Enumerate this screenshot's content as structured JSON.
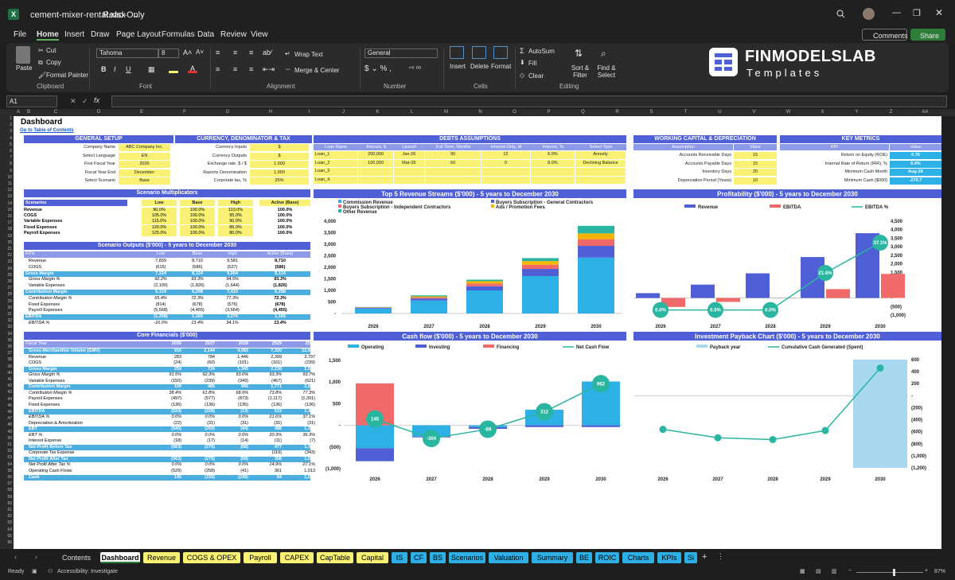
{
  "app": {
    "filename": "cement-mixer-rental.xlsx",
    "mode": "Read-Only"
  },
  "menu": [
    "File",
    "Home",
    "Insert",
    "Draw",
    "Page Layout",
    "Formulas",
    "Data",
    "Review",
    "View"
  ],
  "title_right": {
    "comments": "Comments",
    "share": "Share"
  },
  "ribbon": {
    "paste": "Paste",
    "cut": "Cut",
    "copy": "Copy",
    "format_painter": "Format Painter",
    "clipboard": "Clipboard",
    "font_name": "Tahoma",
    "font_size": "8",
    "font": "Font",
    "wrap": "Wrap Text",
    "merge": "Merge & Center",
    "alignment": "Alignment",
    "number_format": "General",
    "number": "Number",
    "insert": "Insert",
    "delete": "Delete",
    "format": "Format",
    "cells": "Cells",
    "autosum": "AutoSum",
    "fill": "Fill",
    "clear": "Clear",
    "sort": "Sort & Filter",
    "find": "Find & Select",
    "editing": "Editing",
    "logo_main": "FINMODELSLAB",
    "logo_sub": "Templates"
  },
  "name_box": "A1",
  "columns": [
    "A",
    "B",
    "C",
    "D",
    "E",
    "F",
    "G",
    "H",
    "I",
    "J",
    "K",
    "L",
    "M",
    "N",
    "O",
    "P",
    "Q",
    "R",
    "S",
    "T",
    "U",
    "V",
    "W",
    "X",
    "Y",
    "Z",
    "AA",
    "AB",
    "AC"
  ],
  "sheet": {
    "title": "Dashboard",
    "link": "Go to Table of Contents"
  },
  "general": {
    "title": "GENERAL SETUP",
    "rows": [
      [
        "Company Name",
        "ABC Company Inc."
      ],
      [
        "Select Language",
        "EN"
      ],
      [
        "First Fiscal Year",
        "2026"
      ],
      [
        "Fiscal Year End",
        "December"
      ],
      [
        "Select Scenario",
        "Base"
      ]
    ]
  },
  "currency": {
    "title": "CURRENCY, DENOMINATOR & TAX",
    "rows": [
      [
        "Currency Inputs",
        "$"
      ],
      [
        "Currency Outputs",
        "$"
      ],
      [
        "Exchange rate, $ / $",
        "1.000"
      ],
      [
        "Reports Denomination",
        "1,000"
      ],
      [
        "Corporate tax, %",
        "25%"
      ]
    ]
  },
  "debts": {
    "title": "DEBTS ASSUMPTIONS",
    "headers": [
      "Loan Name",
      "Amount, $",
      "Launch",
      "Full Term, Months",
      "Interest-Only, M",
      "Interest, %",
      "Select Type"
    ],
    "rows": [
      [
        "Loan_1",
        "200,000",
        "Jan-26",
        "90",
        "12",
        "6.0%",
        "Annuity"
      ],
      [
        "Loan_2",
        "100,000",
        "Mar-26",
        "60",
        "0",
        "8.0%",
        "Declining Balance"
      ],
      [
        "Loan_3",
        "",
        "",
        "",
        "",
        "",
        ""
      ],
      [
        "Loan_4",
        "",
        "",
        "",
        "",
        "",
        ""
      ]
    ]
  },
  "wc": {
    "title": "WORKING CAPITAL & DEPRECIATION",
    "headers": [
      "Assumption",
      "Value"
    ],
    "rows": [
      [
        "Accounts Receivable Days",
        "15"
      ],
      [
        "Accounts Payable Days",
        "15"
      ],
      [
        "Inventory Days",
        "20"
      ],
      [
        "Depreciation Period (Years)",
        "10"
      ]
    ]
  },
  "kpi": {
    "title": "KEY METRICS",
    "headers": [
      "KPI",
      "Value"
    ],
    "rows": [
      [
        "Return on Equity (ROE)",
        "0.70"
      ],
      [
        "Internal Rate of Return (IRR), %",
        "0.4%"
      ],
      [
        "Minimum Cash Month",
        "Aug-28"
      ],
      [
        "Minimum Cash ($000)",
        "-270.7"
      ]
    ]
  },
  "scen": {
    "title": "Scenario Multiplicators",
    "headers": [
      "Scenarios",
      "Low",
      "Base",
      "High",
      "Active (Base)"
    ],
    "rows": [
      [
        "Revenue",
        "90.0%",
        "100.0%",
        "110.0%",
        "100.0%"
      ],
      [
        "COGS",
        "105.0%",
        "100.0%",
        "95.0%",
        "100.0%"
      ],
      [
        "Variable Expenses",
        "115.0%",
        "100.0%",
        "90.0%",
        "100.0%"
      ],
      [
        "Fixed Expenses",
        "120.0%",
        "100.0%",
        "85.0%",
        "100.0%"
      ],
      [
        "Payroll Expenses",
        "125.0%",
        "100.0%",
        "80.0%",
        "100.0%"
      ]
    ]
  },
  "outputs": {
    "title": "Scenario Outputs ($'000) - 5 years to December 2030",
    "headers": [
      "KPIs",
      "Low",
      "Base",
      "High",
      "Active (Base)"
    ],
    "rows": [
      [
        "Revenue",
        "7,839",
        "8,710",
        "9,581",
        "8,710",
        "n"
      ],
      [
        "COGS",
        "(615)",
        "(586)",
        "(527)",
        "(586)",
        "n"
      ],
      [
        "Gross Margin",
        "7,224",
        "8,124",
        "9,054",
        "8,124",
        "b"
      ],
      [
        "Gross Margin %",
        "92.2%",
        "93.3%",
        "94.5%",
        "93.3%",
        "i"
      ],
      [
        "Variable Expenses",
        "(2,100)",
        "(1,826)",
        "(1,644)",
        "(1,826)",
        "n"
      ],
      [
        "Contribution Margin",
        "5,124",
        "6,298",
        "7,410",
        "6,298",
        "b"
      ],
      [
        "Contribution Margin %",
        "65.4%",
        "72.3%",
        "77.3%",
        "72.3%",
        "i"
      ],
      [
        "Fixed Expenses",
        "(814)",
        "(678)",
        "(576)",
        "(678)",
        "n"
      ],
      [
        "Payroll Expenses",
        "(5,568)",
        "(4,455)",
        "(3,564)",
        "(4,455)",
        "n"
      ],
      [
        "EBITDA",
        "(1,258)",
        "1,165",
        "3,270",
        "1,165",
        "b"
      ],
      [
        "EBITDA %",
        "-16.0%",
        "13.4%",
        "34.1%",
        "13.4%",
        "i"
      ]
    ]
  },
  "core": {
    "title": "Core Financials ($'000)",
    "headers": [
      "Fiscal Year",
      "2026",
      "2027",
      "2028",
      "2029",
      "2030"
    ],
    "rows": [
      [
        "Gross Merchandise Volume (GMV)",
        "916",
        "2,144",
        "4,082",
        "7,320",
        "12,645",
        "b"
      ],
      [
        "Revenue",
        "283",
        "784",
        "1,446",
        "2,399",
        "3,797",
        "n"
      ],
      [
        "COGS",
        "(24)",
        "(60)",
        "(101)",
        "(161)",
        "(239)",
        "n"
      ],
      [
        "Gross Margin",
        "259",
        "724",
        "1,345",
        "2,238",
        "3,558",
        "b"
      ],
      [
        "Gross Margin %",
        "91.5%",
        "92.3%",
        "93.0%",
        "93.3%",
        "93.7%",
        "i"
      ],
      [
        "Variable Expenses",
        "(150)",
        "(239)",
        "(349)",
        "(467)",
        "(621)",
        "n"
      ],
      [
        "Contribution Margin",
        "109",
        "485",
        "996",
        "1,771",
        "2,937",
        "b"
      ],
      [
        "Contribution Margin %",
        "38.4%",
        "61.8%",
        "68.9%",
        "73.8%",
        "77.3%",
        "i"
      ],
      [
        "Payroll Expenses",
        "(497)",
        "(577)",
        "(873)",
        "(1,117)",
        "(1,391)",
        "n"
      ],
      [
        "Fixed Expenses",
        "(136)",
        "(136)",
        "(136)",
        "(136)",
        "(136)",
        "n"
      ],
      [
        "EBITDA",
        "(524)",
        "(228)",
        "(13)",
        "519",
        "1,411",
        "b"
      ],
      [
        "EBITDA %",
        "0.0%",
        "0.0%",
        "0.0%",
        "21.6%",
        "37.1%",
        "i"
      ],
      [
        "Depreciation & Amortization",
        "(22)",
        "(31)",
        "(31)",
        "(31)",
        "(31)",
        "n"
      ],
      [
        "EBT",
        "(545)",
        "(259)",
        "(44)",
        "488",
        "1,380",
        "b"
      ],
      [
        "EBT %",
        "0.0%",
        "0.0%",
        "0.0%",
        "20.3%",
        "36.3%",
        "i"
      ],
      [
        "Interest Expense",
        "(18)",
        "(17)",
        "(14)",
        "(11)",
        "(7)",
        "n"
      ],
      [
        "Net Profit Before Tax",
        "(563)",
        "(276)",
        "(58)",
        "477",
        "1,372",
        "b"
      ],
      [
        "Corporate Tax Expense",
        "",
        "",
        "",
        "(119)",
        "(343)",
        "n"
      ],
      [
        "Net Profit After Tax",
        "(563)",
        "(276)",
        "(58)",
        "358",
        "1,029",
        "b"
      ],
      [
        "Net Profit After Tax %",
        "0.0%",
        "0.0%",
        "0.0%",
        "14.9%",
        "27.1%",
        "i"
      ],
      [
        "Operating Cash Flows",
        "(529)",
        "(258)",
        "(41)",
        "361",
        "1,013",
        "n"
      ],
      [
        "Cash",
        "145",
        "(159)",
        "(248)",
        "64",
        "1,026",
        "b"
      ]
    ]
  },
  "chart_data": [
    {
      "type": "bar",
      "title": "Top 5 Revenue Streams ($'000) - 5 years to December 2030",
      "categories": [
        "2026",
        "2027",
        "2028",
        "2029",
        "2030"
      ],
      "ylim": [
        0,
        4000
      ],
      "yticks": [
        "-",
        "500",
        "1,000",
        "1,500",
        "2,000",
        "2,500",
        "3,000",
        "3,500",
        "4,000"
      ],
      "series": [
        {
          "name": "Commission Revenue",
          "color": "#2cb0e6",
          "values": [
            210,
            560,
            1000,
            1620,
            2420
          ]
        },
        {
          "name": "Buyers Subscription - General Contractors",
          "color": "#4f5fd6",
          "values": [
            30,
            90,
            180,
            310,
            510
          ]
        },
        {
          "name": "Buyers Subscription - Independent Contractors",
          "color": "#f06a6a",
          "values": [
            15,
            50,
            120,
            180,
            290
          ]
        },
        {
          "name": "Ads / Promotion Fees",
          "color": "#f5b400",
          "values": [
            12,
            40,
            100,
            160,
            250
          ]
        },
        {
          "name": "Other Revenue",
          "color": "#2ab5a0",
          "values": [
            16,
            45,
            65,
            130,
            330
          ]
        }
      ]
    },
    {
      "type": "bar",
      "title": "Profitability ($'000) - 5 years to December 2030",
      "categories": [
        "2026",
        "2027",
        "2028",
        "2029",
        "2030"
      ],
      "ylim": [
        -1000,
        4500
      ],
      "yticks": [
        "(1,000)",
        "(500)",
        "-",
        "500",
        "1,000",
        "1,500",
        "2,000",
        "2,500",
        "3,000",
        "3,500",
        "4,000",
        "4,500"
      ],
      "series": [
        {
          "name": "Revenue",
          "color": "#4f5fd6",
          "values": [
            283,
            784,
            1446,
            2399,
            3797
          ]
        },
        {
          "name": "EBITDA",
          "color": "#f06a6a",
          "values": [
            -524,
            -228,
            -13,
            519,
            1411
          ]
        },
        {
          "name": "EBITDA %",
          "color": "#2ab5a0",
          "labels": [
            "0.0%",
            "0.0%",
            "0.0%",
            "21.6%",
            "37.1%"
          ]
        }
      ]
    },
    {
      "type": "bar",
      "title": "Cash flow ($'000) - 5 years to December 2030",
      "categories": [
        "2026",
        "2027",
        "2028",
        "2029",
        "2030"
      ],
      "ylim": [
        -1000,
        1500
      ],
      "yticks": [
        "(1,000)",
        "(500)",
        "-",
        "500",
        "1,000",
        "1,500"
      ],
      "series": [
        {
          "name": "Operating",
          "color": "#2cb0e6",
          "values": [
            -529,
            -258,
            -41,
            361,
            1013
          ]
        },
        {
          "name": "Investing",
          "color": "#4f5fd6",
          "values": [
            -300,
            -20,
            -40,
            -40,
            -40
          ]
        },
        {
          "name": "Financing",
          "color": "#f06a6a",
          "values": [
            970,
            0,
            0,
            0,
            0
          ]
        },
        {
          "name": "Net Cash Flow",
          "color": "#2ab5a0",
          "values": [
            145,
            -304,
            -89,
            312,
            962
          ]
        }
      ]
    },
    {
      "type": "line",
      "title": "Investment Payback Chart ($'000) - 5 years to December 2030",
      "categories": [
        "2026",
        "2027",
        "2028",
        "2029",
        "2030"
      ],
      "ylim": [
        -1200,
        600
      ],
      "yticks": [
        "(1,200)",
        "(1,000)",
        "(800)",
        "(600)",
        "(400)",
        "(200)",
        "-",
        "200",
        "400",
        "600"
      ],
      "series": [
        {
          "name": "Payback year",
          "color": "#a7d8f0",
          "values": [
            0,
            0,
            0,
            0,
            1
          ]
        },
        {
          "name": "Cumulative Cash Generated (Spent)",
          "color": "#2ab5a0",
          "values": [
            -560,
            -700,
            -730,
            -580,
            460
          ]
        }
      ]
    }
  ],
  "tabs": [
    {
      "n": "Contents",
      "c": ""
    },
    {
      "n": "Dashboard",
      "c": "#fff"
    },
    {
      "n": "Revenue",
      "c": "#f8f174"
    },
    {
      "n": "COGS & OPEX",
      "c": "#f8f174"
    },
    {
      "n": "Payroll",
      "c": "#f8f174"
    },
    {
      "n": "CAPEX",
      "c": "#f8f174"
    },
    {
      "n": "CapTable",
      "c": "#f8f174"
    },
    {
      "n": "Capital",
      "c": "#f8f174"
    },
    {
      "n": "IS",
      "c": "#2cb0e6"
    },
    {
      "n": "CF",
      "c": "#2cb0e6"
    },
    {
      "n": "BS",
      "c": "#2cb0e6"
    },
    {
      "n": "Scenarios",
      "c": "#2cb0e6"
    },
    {
      "n": "Valuation",
      "c": "#2cb0e6"
    },
    {
      "n": "Summary",
      "c": "#2cb0e6"
    },
    {
      "n": "BE",
      "c": "#2cb0e6"
    },
    {
      "n": "ROIC",
      "c": "#2cb0e6"
    },
    {
      "n": "Charts",
      "c": "#2cb0e6"
    },
    {
      "n": "KPIs",
      "c": "#2cb0e6"
    },
    {
      "n": "Si",
      "c": "#2cb0e6"
    }
  ],
  "status": {
    "ready": "Ready",
    "access": "Accessibility: Investigate",
    "zoom": "87%"
  }
}
